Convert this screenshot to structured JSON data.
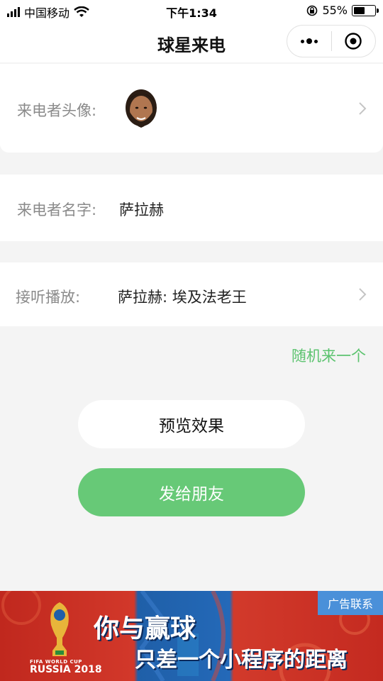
{
  "status_bar": {
    "carrier": "中国移动",
    "time": "下午1:34",
    "battery": "55%",
    "battery_level": 0.55
  },
  "nav": {
    "title": "球星来电"
  },
  "caller_avatar": {
    "label": "来电者头像:"
  },
  "caller_name": {
    "label": "来电者名字:",
    "value": "萨拉赫"
  },
  "playback": {
    "label": "接听播放:",
    "value": "萨拉赫: 埃及法老王"
  },
  "random_link": "随机来一个",
  "buttons": {
    "preview": "预览效果",
    "send": "发给朋友"
  },
  "ad": {
    "contact": "广告联系",
    "brand_small": "FIFA WORLD CUP",
    "brand": "RUSSIA 2018",
    "line1": "你与赢球",
    "line2": "只差一个小程序的距离"
  },
  "colors": {
    "accent_green": "#67c977",
    "link_green": "#5cc36f",
    "ad_blue": "#4a90d9"
  },
  "icons": [
    "signal-icon",
    "wifi-icon",
    "lock-rotation-icon",
    "battery-icon",
    "more-dots-icon",
    "target-icon",
    "chevron-right-icon",
    "trophy-icon"
  ]
}
